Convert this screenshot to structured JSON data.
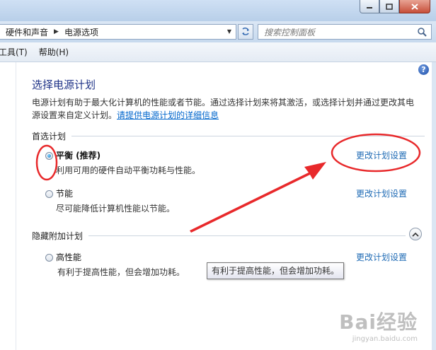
{
  "address": {
    "segments": [
      "硬件和声音",
      "电源选项"
    ]
  },
  "search": {
    "placeholder": "搜索控制面板"
  },
  "menu": {
    "items": [
      "工具(T)",
      "帮助(H)"
    ]
  },
  "page": {
    "help_label": "?",
    "title": "选择电源计划",
    "description": "电源计划有助于最大化计算机的性能或者节能。通过选择计划来将其激活，或选择计划并通过更改其电源设置来自定义计划。",
    "description_link": "请提供电源计划的详细信息"
  },
  "preferred": {
    "header": "首选计划",
    "plans": [
      {
        "name": "平衡 (推荐)",
        "desc": "利用可用的硬件自动平衡功耗与性能。",
        "change": "更改计划设置",
        "selected": true
      },
      {
        "name": "节能",
        "desc": "尽可能降低计算机性能以节能。",
        "change": "更改计划设置",
        "selected": false
      }
    ]
  },
  "hidden": {
    "header": "隐藏附加计划",
    "plans": [
      {
        "name": "高性能",
        "desc": "有利于提高性能，但会增加功耗。",
        "change": "更改计划设置",
        "selected": false
      }
    ]
  },
  "tooltip": "有利于提高性能，但会增加功耗。",
  "watermark": {
    "brand": "Bai经验",
    "url": "jingyan.baidu.com"
  },
  "colors": {
    "annotation": "#e8292b",
    "title": "#1e3287",
    "link": "#1f6bb5"
  },
  "icons": [
    "minimize-icon",
    "maximize-icon",
    "close-icon",
    "refresh-icon",
    "search-icon",
    "help-icon",
    "collapse-icon"
  ]
}
